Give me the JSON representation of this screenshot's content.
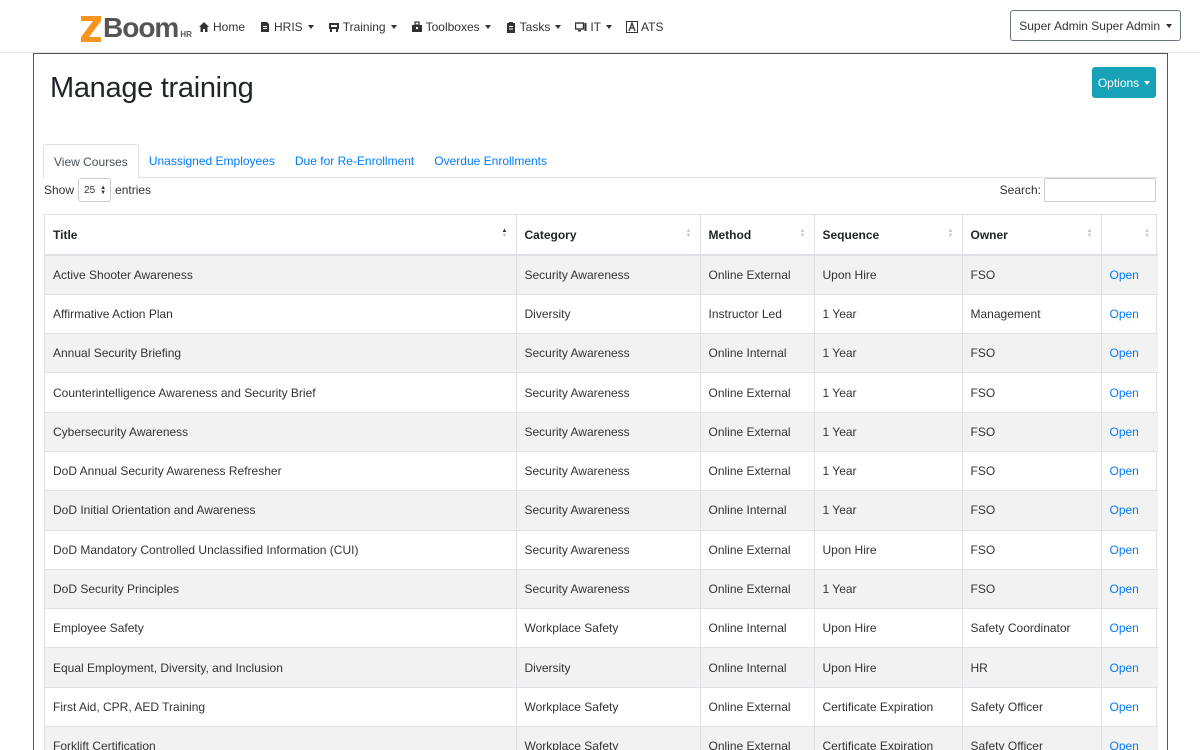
{
  "brand": {
    "name": "Boom",
    "sub": "HR"
  },
  "nav": {
    "items": [
      {
        "label": "Home",
        "icon": "home-icon",
        "dropdown": false
      },
      {
        "label": "HRIS",
        "icon": "document-icon",
        "dropdown": true
      },
      {
        "label": "Training",
        "icon": "training-icon",
        "dropdown": true
      },
      {
        "label": "Toolboxes",
        "icon": "toolbox-icon",
        "dropdown": true
      },
      {
        "label": "Tasks",
        "icon": "clipboard-icon",
        "dropdown": true
      },
      {
        "label": "IT",
        "icon": "monitor-icon",
        "dropdown": true
      },
      {
        "label": "ATS",
        "icon": "ats-icon",
        "dropdown": false
      }
    ],
    "user": "Super Admin Super Admin"
  },
  "page": {
    "title": "Manage training",
    "options_label": "Options"
  },
  "tabs": [
    "View Courses",
    "Unassigned Employees",
    "Due for Re-Enrollment",
    "Overdue Enrollments"
  ],
  "table_controls": {
    "show_label": "Show",
    "length_value": "25",
    "entries_label": "entries",
    "search_label": "Search:"
  },
  "table": {
    "columns": [
      "Title",
      "Category",
      "Method",
      "Sequence",
      "Owner",
      ""
    ],
    "rows": [
      [
        "Active Shooter Awareness",
        "Security Awareness",
        "Online External",
        "Upon Hire",
        "FSO",
        "Open"
      ],
      [
        "Affirmative Action Plan",
        "Diversity",
        "Instructor Led",
        "1 Year",
        "Management",
        "Open"
      ],
      [
        "Annual Security Briefing",
        "Security Awareness",
        "Online Internal",
        "1 Year",
        "FSO",
        "Open"
      ],
      [
        "Counterintelligence Awareness and Security Brief",
        "Security Awareness",
        "Online External",
        "1 Year",
        "FSO",
        "Open"
      ],
      [
        "Cybersecurity Awareness",
        "Security Awareness",
        "Online External",
        "1 Year",
        "FSO",
        "Open"
      ],
      [
        "DoD Annual Security Awareness Refresher",
        "Security Awareness",
        "Online External",
        "1 Year",
        "FSO",
        "Open"
      ],
      [
        "DoD Initial Orientation and Awareness",
        "Security Awareness",
        "Online Internal",
        "1 Year",
        "FSO",
        "Open"
      ],
      [
        "DoD Mandatory Controlled Unclassified Information (CUI)",
        "Security Awareness",
        "Online External",
        "Upon Hire",
        "FSO",
        "Open"
      ],
      [
        "DoD Security Principles",
        "Security Awareness",
        "Online External",
        "1 Year",
        "FSO",
        "Open"
      ],
      [
        "Employee Safety",
        "Workplace Safety",
        "Online Internal",
        "Upon Hire",
        "Safety Coordinator",
        "Open"
      ],
      [
        "Equal Employment, Diversity, and Inclusion",
        "Diversity",
        "Online Internal",
        "Upon Hire",
        "HR",
        "Open"
      ],
      [
        "First Aid, CPR, AED Training",
        "Workplace Safety",
        "Online External",
        "Certificate Expiration",
        "Safety Officer",
        "Open"
      ],
      [
        "Forklift Certification",
        "Workplace Safety",
        "Online External",
        "Certificate Expiration",
        "Safety Officer",
        "Open"
      ]
    ]
  },
  "colors": {
    "accent": "#17a2b8",
    "link": "#007bff",
    "logo_orange": "#f7941d"
  }
}
